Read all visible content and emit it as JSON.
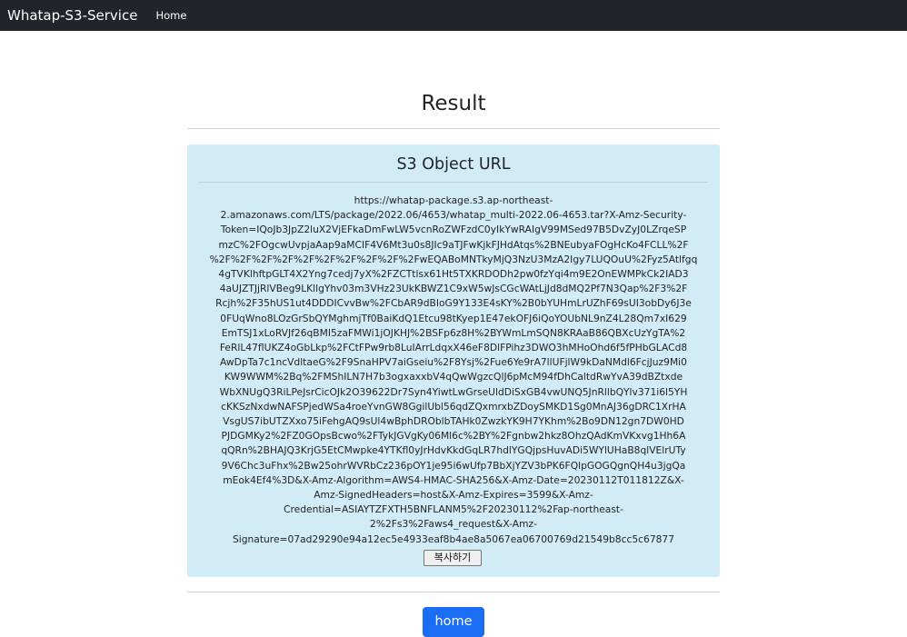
{
  "navbar": {
    "brand": "Whatap-S3-Service",
    "home_link": "Home"
  },
  "page": {
    "title": "Result"
  },
  "card": {
    "title": "S3 Object URL",
    "url": "https://whatap-package.s3.ap-northeast-\n2.amazonaws.com/LTS/package/2022.06/4653/whatap_multi-2022.06-4653.tar?X-Amz-Security-\nToken=IQoJb3JpZ2luX2VjEFkaDmFwLW5vcnRoZWFzdC0yIkYwRAIgV99MSed97B5DvZyJ0LZrqeSP\nmzC%2FOgcwUvpjaAap9aMCIF4V6Mt3u0s8JIc9aTJFwKjkFJHdAtqs%2BNEubyaFOgHcKo4FCLL%2F\n%2F%2F%2F%2F%2F%2F%2F%2F%2F%2FwEQABoMNTkyMjQ3NzU3MzA2Igy7LUQOuU%2Fyz5Atlfgq\n4gTVKlhftpGLT4X2Yng7cedj7yX%2FZCTtlsx61Ht5TXKRDODh2pw0fzYqi4m9E2OnEWMPkCk2IAD3\n4aUJZTJjRlVBeg9LKllgYhv03m3VHz23UkKBWZ1C9xW5wJsCGcWAtLjJd8dMQ2Pf7N3Qap%2F3%2F\nRcjh%2F35hUS1ut4DDDICvvBw%2FCbAR9dBIoG9Y133E4sKY%2B0bYUHmLrUZhF69sUI3obDy6J3e\n0FUqWno8LOzGrSbQYMghmjTf0BaiKdQ1Etcu98tKyep1E47ekOFJ6iQoYOUbNL9nZ4L28Qm7xI629\nEmTSJ1xLoRVJf26qBMI5zaFMWi1jOJKHJ%2BSFp6z8H%2BYWmLmSQN8KRAaB86QBXcUzYgTA%2\nFeRlL47flUKZ4oGbLkp%2FCtFPw9rb8LuIArrLdqxX46eF8DlFPihz3DWO3hMHoOhd6f5fPHbGLACd8\nAwDpTa7c1ncVdltaeG%2F9SnaHPV7aiGseiu%2F8Ysj%2Fue6Ye9rA7llUFjlW9kDaNMdl6FcjJuz9Mi0\nKW9WWM%2Bq%2FMShILN7H7b3ogxaxxbV4qQwWgzcQlJ6pMcM94fDhCaltdRwYvA39dBZtxde\nWbXNUgQ3RiLPeJsrCicOJk2O39622Dr7Syn4YiwtLwGrseUldDiSxGB4vwUNQ5JnRllbQYlv371i6l5YH\ncKKSzNxdwNAFSPjedWSa4roeYvnGW8GgilUbl56qdZQxmrxbZDoySMKD1Sg0MnAJ36gDRC1XrHA\nVsgUS7ibUTZXxo75iFehgAQ9sUl4wBphDROblbTAHk0ZwzkYK9H7YKhm%2Bo9DN12gn7DW0HD\nPJDGMKy2%2FZ0GOpsBcwo%2FTykJGVgKy06Ml6c%2BY%2Fgnbw2hkz8OhzQAdKmVKxvg1Hh6A\nqQRn%2BHAJQ3KrjG5EtCMwpke4YTKfl0yJrHdvKkdGqLR7hdlYGQjpsHuvADi5WYlUHaB8qlVElrUTy\n9V6Chc3uFhx%2Bw25ohrWVRbCz236pOY1je95i6wUfp7BbXjYZV3bPK6FQlpGOGQgnQH4u3jgQa\nmEok4Ef4%3D&X-Amz-Algorithm=AWS4-HMAC-SHA256&X-Amz-Date=20230112T011812Z&X-\nAmz-SignedHeaders=host&X-Amz-Expires=3599&X-Amz-\nCredential=ASIAYTZFXTH5BNFLANM5%2F20230112%2Fap-northeast-\n2%2Fs3%2Faws4_request&X-Amz-\nSignature=07ad29290e94a12ec5e4933eaf8b4ae8a5067ea06700769d21549b8cc5c67877",
    "copy_button": "복사하기"
  },
  "footer": {
    "home_button": "home"
  },
  "colors": {
    "navbar_bg": "#212529",
    "card_bg": "#d1ecf7",
    "primary_button": "#1b6ef3"
  }
}
